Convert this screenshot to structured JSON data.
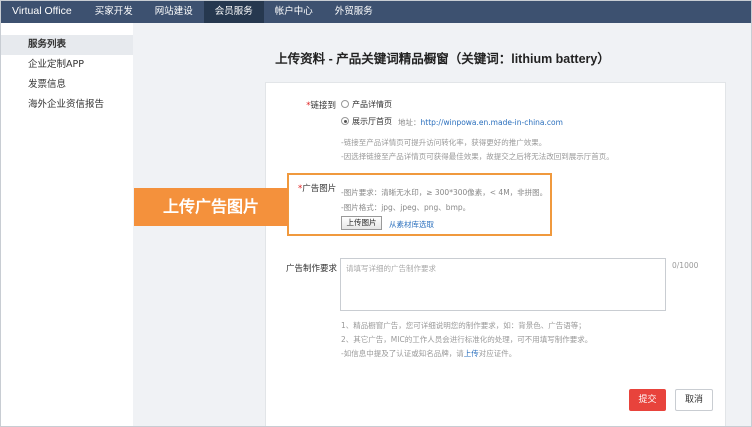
{
  "topnav": {
    "items": [
      "Virtual Office",
      "买家开发",
      "网站建设",
      "会员服务",
      "帐户中心",
      "外贸服务"
    ],
    "active_index": 3
  },
  "sidebar": {
    "items": [
      "服务列表",
      "企业定制APP",
      "发票信息",
      "海外企业资信报告"
    ],
    "active_index": 0
  },
  "page": {
    "title": "上传资料 - 产品关键词精品橱窗（关键词：lithium battery）"
  },
  "link_section": {
    "required_mark": "*",
    "label": "链接到",
    "option_product": "产品详情页",
    "option_showroom": "展示厅首页",
    "selected": "option_showroom",
    "address_label": "地址：",
    "address_url": "http://winpowa.en.made-in-china.com",
    "hint_1": "-链接至产品详情页可提升访问转化率，获得更好的推广效果。",
    "hint_2": "-因选择链接至产品详情页可获得最佳效果，故提交之后将无法改回到展示厅首页。"
  },
  "image_section": {
    "required_mark": "*",
    "label": "广告图片",
    "requirement": "-图片要求：清晰无水印，≥ 300*300像素，< 4M，非拼图。",
    "format": "-图片格式：jpg、jpeg、png、bmp。",
    "upload_button": "上传图片",
    "library_link": "从素材库选取"
  },
  "callout": {
    "text": "上传广告图片"
  },
  "request_section": {
    "label": "广告制作要求",
    "placeholder": "请填写详细的广告制作要求",
    "counter": "0/1000",
    "note_1": "1、精品橱窗广告，您可详细说明您的制作要求，如：背景色、广告语等；",
    "note_2": "2、其它广告，MIC的工作人员会进行标准化的处理，可不用填写制作要求。",
    "note_3_prefix": "-如信息中提及了认证或知名品牌，请",
    "note_3_link": "上传",
    "note_3_suffix": "对应证件。"
  },
  "actions": {
    "submit": "提交",
    "cancel": "取消"
  },
  "colors": {
    "nav_bg": "#3d5170",
    "nav_active": "#26384f",
    "highlight_orange": "#f4913c",
    "submit_red": "#e8433c",
    "link_blue": "#2a6fbd"
  }
}
